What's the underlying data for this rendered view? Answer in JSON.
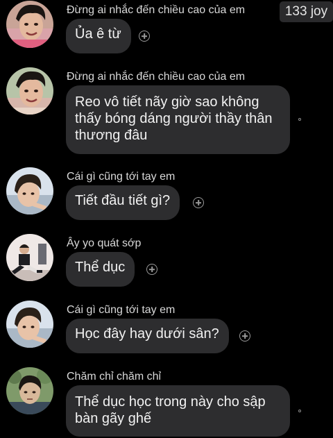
{
  "badge": {
    "text": "133 joy"
  },
  "messages": [
    {
      "sender": "Đừng ai nhắc đến chiều cao của em",
      "lines": [
        "Ủa ê từ"
      ],
      "avatar": "boy-smiling-avatar",
      "action": "add-reaction-icon"
    },
    {
      "sender": "Đừng ai nhắc đến chiều cao của em",
      "lines": [
        "Reo vô tiết nãy giờ sao không",
        "thấy bóng dáng người thầy thân",
        "thương đâu"
      ],
      "avatar": "boy-smiling-avatar",
      "action": "seen-indicator"
    },
    {
      "sender": "Cái gì cũng tới tay em",
      "lines": [
        "Tiết đầu tiết gì?"
      ],
      "avatar": "boy-lying-avatar",
      "action": "add-reaction-icon"
    },
    {
      "sender": "Ây yo quát sớp",
      "lines": [
        "Thể dục"
      ],
      "avatar": "person-sitting-avatar",
      "action": "add-reaction-icon"
    },
    {
      "sender": "Cái gì cũng tới tay em",
      "lines": [
        "Học đây hay dưới sân?"
      ],
      "avatar": "boy-lying-avatar",
      "action": "add-reaction-icon"
    },
    {
      "sender": "Chăm chỉ chăm chỉ",
      "lines": [
        "Thể dục học trong này cho sập",
        "bàn gãy ghế"
      ],
      "avatar": "boy-outdoor-avatar",
      "action": "seen-indicator"
    }
  ],
  "colors": {
    "background": "#000000",
    "bubble": "#2d2d2f",
    "text": "#f2f2f2",
    "sender": "#d9d9d9",
    "icon": "#9a9a9a"
  }
}
